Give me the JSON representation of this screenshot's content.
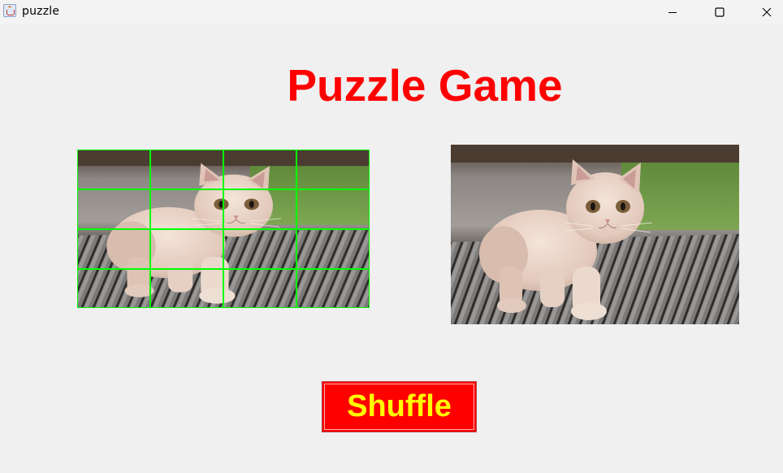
{
  "window": {
    "title": "puzzle",
    "icon": "java-cup-icon"
  },
  "heading": "Puzzle Game",
  "puzzle_board": {
    "rows": 4,
    "columns": 4,
    "grid_color": "#00ff00",
    "image": "kitten-photo"
  },
  "reference_image": "kitten-photo",
  "shuffle_button": {
    "label": "Shuffle",
    "background": "#ff0000",
    "text_color": "#ffff00"
  },
  "colors": {
    "heading": "#ff0000",
    "background": "#f0f0f0"
  }
}
